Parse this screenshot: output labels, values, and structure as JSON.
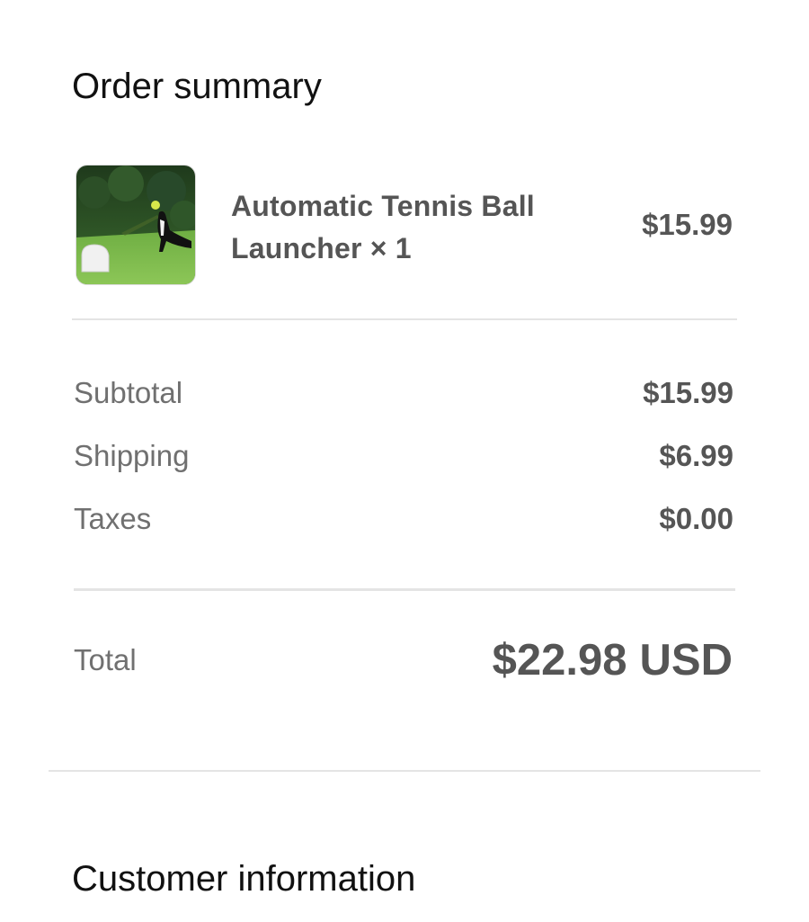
{
  "order_summary": {
    "title": "Order summary",
    "line_items": [
      {
        "name": "Automatic Tennis Ball Launcher",
        "quantity_text": "× 1",
        "price": "$15.99",
        "image_icon": "product-photo-dog-with-ball-launcher"
      }
    ],
    "subtotal": {
      "label": "Subtotal",
      "value": "$15.99"
    },
    "shipping": {
      "label": "Shipping",
      "value": "$6.99"
    },
    "taxes": {
      "label": "Taxes",
      "value": "$0.00"
    },
    "total": {
      "label": "Total",
      "amount": "$22.98",
      "currency": "USD"
    }
  },
  "customer_information": {
    "title": "Customer information"
  },
  "colors": {
    "title_text": "#111111",
    "value_text": "#555555",
    "label_text": "#707070",
    "divider": "#e4e4e4"
  }
}
